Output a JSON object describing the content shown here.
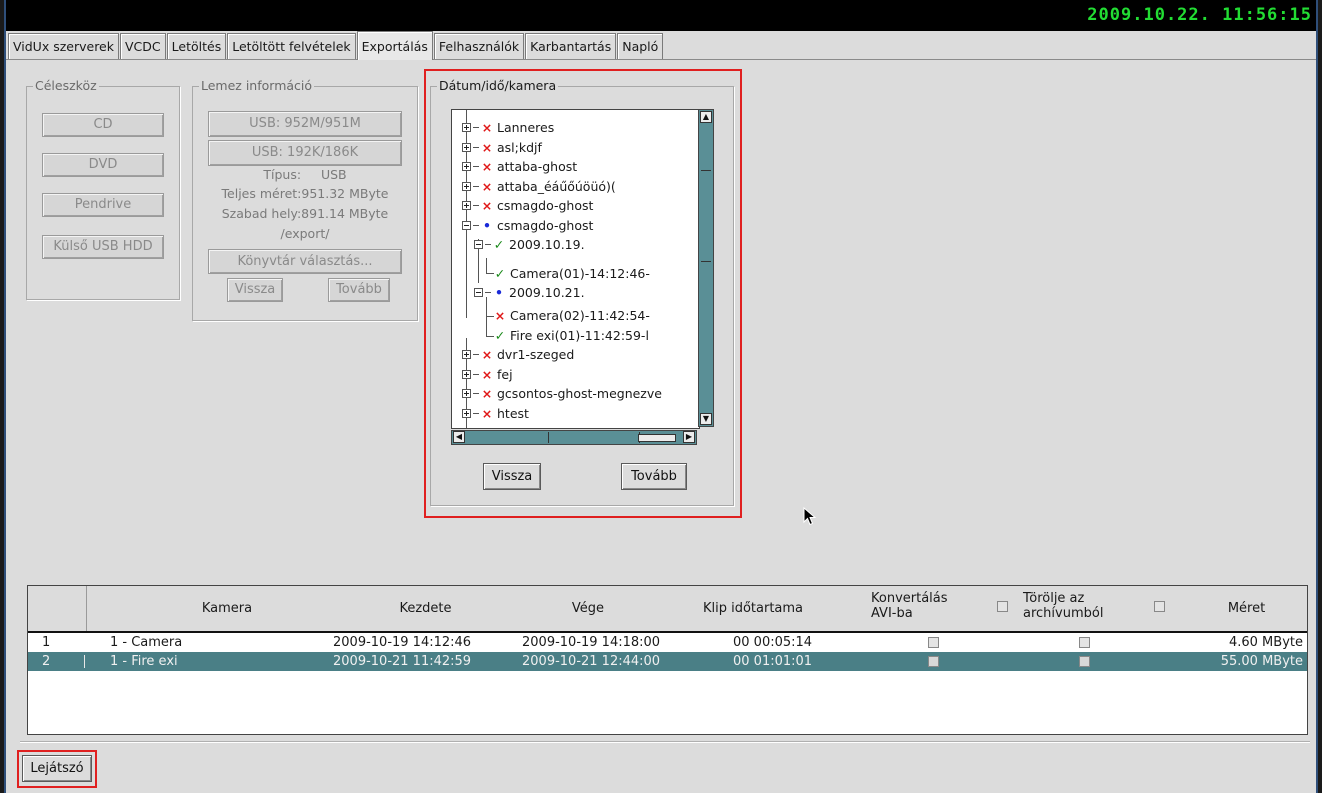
{
  "clock": "2009.10.22.  11:56:15",
  "tabs": [
    "VidUx szerverek",
    "VCDC",
    "Letöltés",
    "Letöltött felvételek",
    "Exportálás",
    "Felhasználók",
    "Karbantartás",
    "Napló"
  ],
  "active_tab": "Exportálás",
  "target_group": {
    "legend": "Céleszköz",
    "buttons": [
      "CD",
      "DVD",
      "Pendrive",
      "Külső USB HDD"
    ]
  },
  "disk_group": {
    "legend": "Lemez információ",
    "usb1": "USB: 952M/951M",
    "usb2": "USB: 192K/186K",
    "type_line": "Típus:     USB",
    "total_line": "Teljes méret:951.32 MByte",
    "free_line": "Szabad hely:891.14 MByte",
    "path_line": "/export/",
    "dir_button": "Könyvtár választás...",
    "back_button": "Vissza",
    "next_button": "Tovább"
  },
  "date_group": {
    "legend": "Dátum/idő/kamera",
    "tree": [
      "Lanneres",
      "asl;kdjf",
      "attaba-ghost",
      "attaba_éáűőúöüó)(",
      "csmagdo-ghost",
      "csmagdo-ghost",
      "2009.10.19.",
      "Camera(01)-14:12:46-",
      "2009.10.21.",
      "Camera(02)-11:42:54-",
      "Fire exi(01)-11:42:59-l",
      "dvr1-szeged",
      "fej",
      "gcsontos-ghost-megnezve",
      "htest"
    ],
    "back_button": "Vissza",
    "next_button": "Tovább"
  },
  "table": {
    "headers": {
      "camera": "Kamera",
      "start": "Kezdete",
      "end": "Vége",
      "duration": "Klip időtartama",
      "convert_1": "Konvertálás",
      "convert_2": "AVI-ba",
      "delete_1": "Törölje az",
      "delete_2": "archívumból",
      "size": "Méret"
    },
    "rows": [
      {
        "num": "1",
        "camera": "1 - Camera",
        "start": "2009-10-19 14:12:46",
        "end": "2009-10-19 14:18:00",
        "duration": "00 00:05:14",
        "size": "4.60 MByte"
      },
      {
        "num": "2",
        "camera": "1 - Fire exi",
        "start": "2009-10-21 11:42:59",
        "end": "2009-10-21 12:44:00",
        "duration": "00 01:01:01",
        "size": "55.00 MByte"
      }
    ]
  },
  "player_button": "Lejátszó",
  "colors": {
    "highlight": "#e02020",
    "selection": "#4a7f86",
    "clock": "#22dd33"
  }
}
